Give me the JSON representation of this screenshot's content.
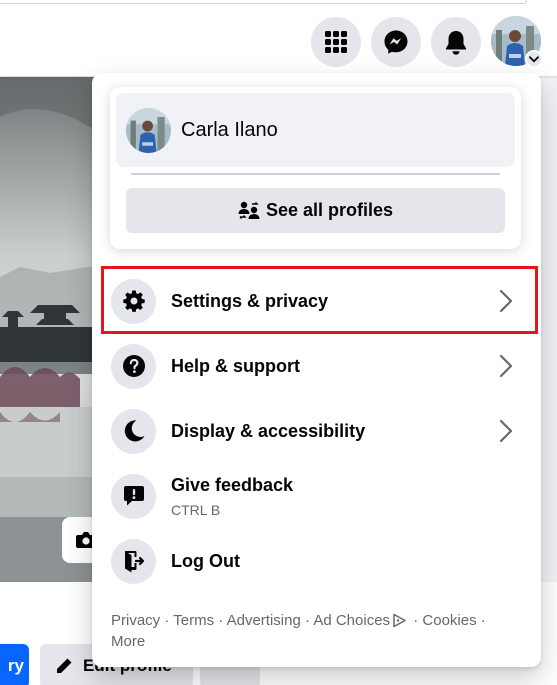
{
  "account_menu": {
    "profile_name": "Carla Ilano",
    "see_all_profiles_label": "See all profiles",
    "items": [
      {
        "label": "Settings & privacy",
        "icon": "gear-icon",
        "has_submenu": true,
        "highlighted": true
      },
      {
        "label": "Help & support",
        "icon": "question-icon",
        "has_submenu": true
      },
      {
        "label": "Display & accessibility",
        "icon": "moon-icon",
        "has_submenu": true
      },
      {
        "label": "Give feedback",
        "sublabel": "CTRL B",
        "icon": "feedback-icon"
      },
      {
        "label": "Log Out",
        "icon": "logout-icon"
      }
    ],
    "footer": {
      "links": [
        "Privacy",
        "Terms",
        "Advertising",
        "Ad Choices",
        "Cookies",
        "More"
      ],
      "separator": " · "
    }
  },
  "page": {
    "story_button_label": "ry",
    "edit_profile_label": "Edit profile"
  },
  "colors": {
    "accent_blue": "#0866ff",
    "highlight_red": "#e3151f",
    "button_gray": "#e4e6eb",
    "secondary_text": "#65676b"
  }
}
